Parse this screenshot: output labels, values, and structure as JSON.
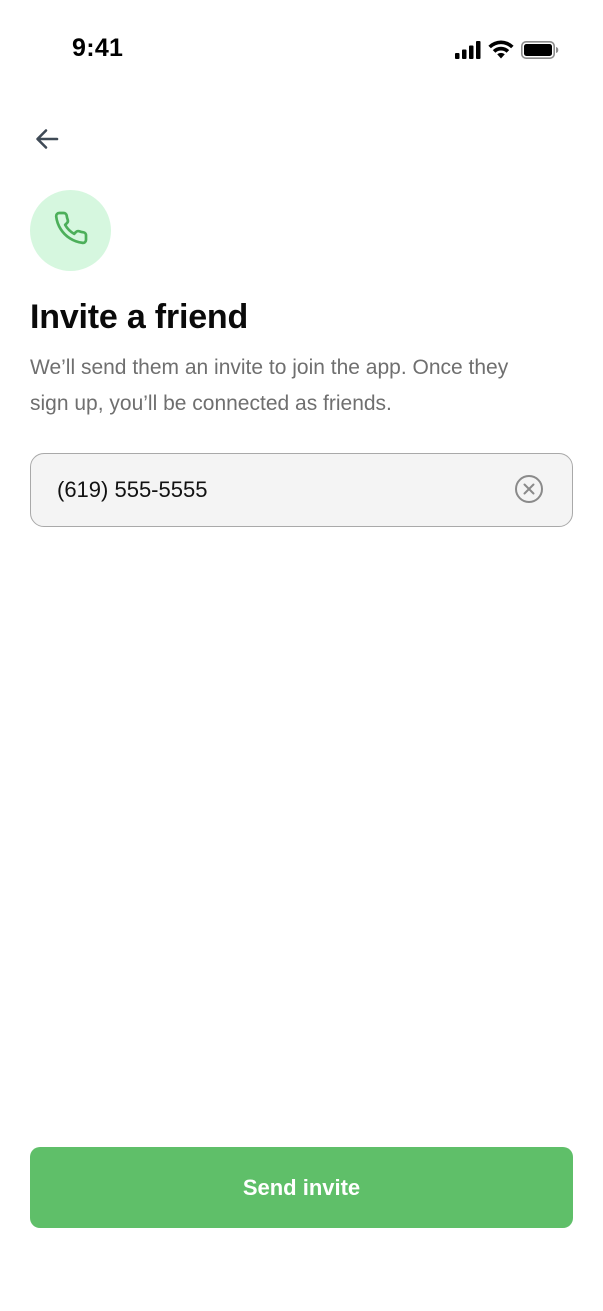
{
  "status_bar": {
    "time": "9:41",
    "icons": [
      "cellular-signal-icon",
      "wifi-icon",
      "battery-icon"
    ]
  },
  "nav": {
    "back_icon": "arrow-left-icon"
  },
  "header": {
    "badge_icon": "phone-icon",
    "title": "Invite a friend",
    "subtitle": "We’ll send them an invite to join the app. Once they sign up, you’ll be connected as friends."
  },
  "phone_field": {
    "value": "(619) 555-5555",
    "clear_icon": "clear-circle-x-icon"
  },
  "actions": {
    "send_label": "Send invite"
  },
  "colors": {
    "accent_green": "#5fbf69",
    "badge_bg": "#d6f7df",
    "badge_icon": "#4caf5a",
    "subtitle_text": "#6f6f6f",
    "field_bg": "#f4f4f4",
    "field_border": "#a9a9a9"
  }
}
